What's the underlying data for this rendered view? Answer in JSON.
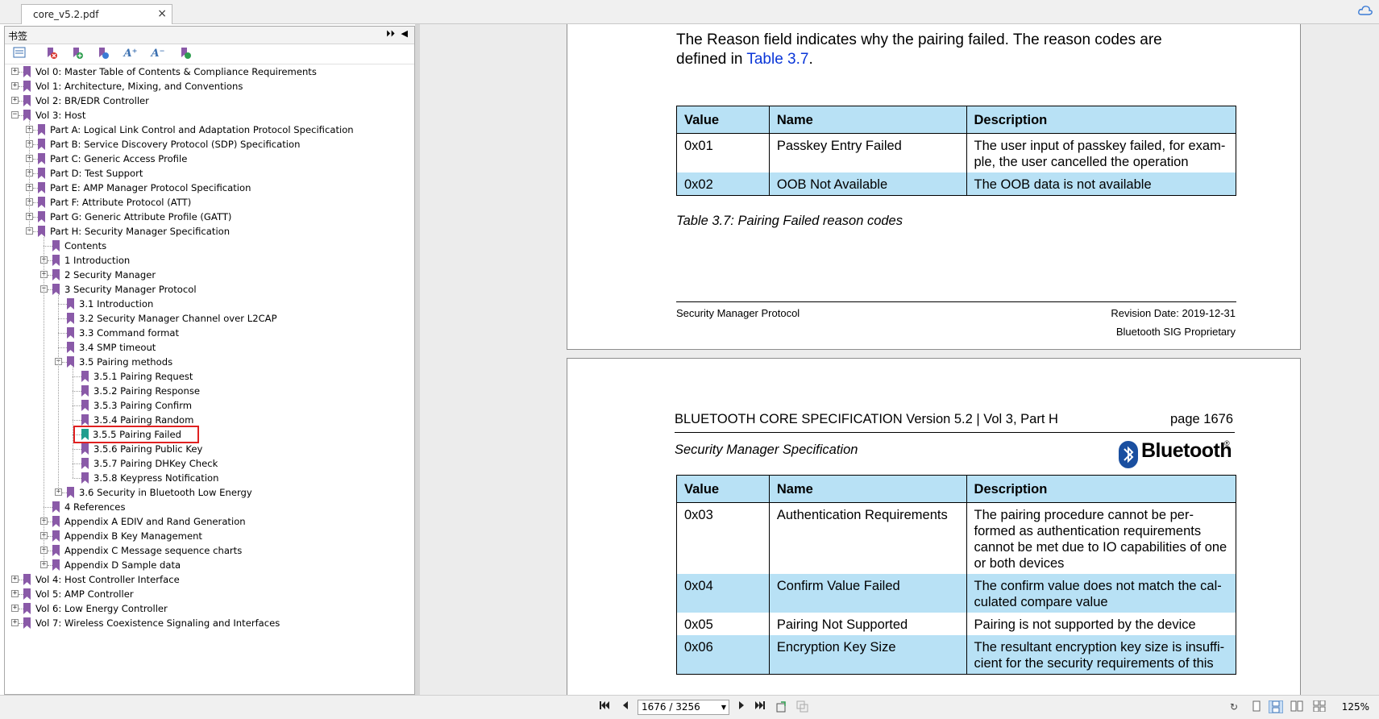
{
  "tab": {
    "title": "core_v5.2.pdf",
    "close_symbol": "×"
  },
  "sidebar": {
    "title": "书签",
    "pin_symbol": "⏵⏵",
    "collapse_symbol": "◀",
    "toolbar": {
      "aplus": "A⁺",
      "aminus": "A⁻"
    },
    "tree": [
      {
        "label": "Vol 0: Master Table of Contents & Compliance Requirements",
        "level": 0,
        "expander": "+"
      },
      {
        "label": "Vol 1: Architecture, Mixing, and Conventions",
        "level": 0,
        "expander": "+"
      },
      {
        "label": "Vol 2: BR/EDR Controller",
        "level": 0,
        "expander": "+"
      },
      {
        "label": "Vol 3: Host",
        "level": 0,
        "expander": "-"
      },
      {
        "label": "Part A: Logical Link Control and Adaptation Protocol Specification",
        "level": 1,
        "expander": "+"
      },
      {
        "label": "Part B: Service Discovery Protocol (SDP) Specification",
        "level": 1,
        "expander": "+"
      },
      {
        "label": "Part C: Generic Access Profile",
        "level": 1,
        "expander": "+"
      },
      {
        "label": "Part D: Test Support",
        "level": 1,
        "expander": "+"
      },
      {
        "label": "Part E: AMP Manager Protocol Specification",
        "level": 1,
        "expander": "+"
      },
      {
        "label": "Part F: Attribute Protocol (ATT)",
        "level": 1,
        "expander": "+"
      },
      {
        "label": "Part G: Generic Attribute Profile (GATT)",
        "level": 1,
        "expander": "+"
      },
      {
        "label": "Part H: Security Manager Specification",
        "level": 1,
        "expander": "-"
      },
      {
        "label": "Contents",
        "level": 2,
        "expander": ""
      },
      {
        "label": "1 Introduction",
        "level": 2,
        "expander": "+"
      },
      {
        "label": "2 Security Manager",
        "level": 2,
        "expander": "+"
      },
      {
        "label": "3 Security Manager Protocol",
        "level": 2,
        "expander": "-"
      },
      {
        "label": "3.1 Introduction",
        "level": 3,
        "expander": ""
      },
      {
        "label": "3.2 Security Manager Channel over L2CAP",
        "level": 3,
        "expander": ""
      },
      {
        "label": "3.3 Command format",
        "level": 3,
        "expander": ""
      },
      {
        "label": "3.4 SMP timeout",
        "level": 3,
        "expander": ""
      },
      {
        "label": "3.5 Pairing methods",
        "level": 3,
        "expander": "-"
      },
      {
        "label": "3.5.1 Pairing Request",
        "level": 4,
        "expander": ""
      },
      {
        "label": "3.5.2 Pairing Response",
        "level": 4,
        "expander": ""
      },
      {
        "label": "3.5.3 Pairing Confirm",
        "level": 4,
        "expander": ""
      },
      {
        "label": "3.5.4 Pairing Random",
        "level": 4,
        "expander": ""
      },
      {
        "label": "3.5.5 Pairing Failed",
        "level": 4,
        "expander": "",
        "selected": true
      },
      {
        "label": "3.5.6 Pairing Public Key",
        "level": 4,
        "expander": ""
      },
      {
        "label": "3.5.7 Pairing DHKey Check",
        "level": 4,
        "expander": ""
      },
      {
        "label": "3.5.8 Keypress Notification",
        "level": 4,
        "expander": ""
      },
      {
        "label": "3.6 Security in Bluetooth Low Energy",
        "level": 3,
        "expander": "+"
      },
      {
        "label": "4 References",
        "level": 2,
        "expander": ""
      },
      {
        "label": "Appendix A EDIV and Rand Generation",
        "level": 2,
        "expander": "+"
      },
      {
        "label": "Appendix B Key Management",
        "level": 2,
        "expander": "+"
      },
      {
        "label": "Appendix C Message sequence charts",
        "level": 2,
        "expander": "+"
      },
      {
        "label": "Appendix D Sample data",
        "level": 2,
        "expander": "+"
      },
      {
        "label": "Vol 4: Host Controller Interface",
        "level": 0,
        "expander": "+"
      },
      {
        "label": "Vol 5: AMP Controller",
        "level": 0,
        "expander": "+"
      },
      {
        "label": "Vol 6: Low Energy Controller",
        "level": 0,
        "expander": "+"
      },
      {
        "label": "Vol 7: Wireless Coexistence Signaling and Interfaces",
        "level": 0,
        "expander": "+"
      }
    ]
  },
  "page1": {
    "intro_line1": "The Reason field indicates why the pairing failed. The reason codes are",
    "intro_line2_prefix": "defined in ",
    "intro_link": "Table 3.7",
    "intro_line2_suffix": ".",
    "table_headers": [
      "Value",
      "Name",
      "Description"
    ],
    "rows": [
      {
        "value": "0x01",
        "name": "Passkey Entry Failed",
        "desc": [
          "The user input of passkey failed, for exam-",
          "ple, the user cancelled the operation"
        ]
      },
      {
        "value": "0x02",
        "name": "OOB Not Available",
        "desc": [
          "The OOB data is not available"
        ]
      }
    ],
    "caption": "Table 3.7:  Pairing Failed reason codes",
    "footer_left": "Security Manager Protocol",
    "footer_right1": "Revision Date: 2019-12-31",
    "footer_right2": "Bluetooth SIG Proprietary"
  },
  "page2": {
    "header_left": "BLUETOOTH CORE SPECIFICATION Version 5.2 | Vol 3, Part H",
    "header_right": "page 1676",
    "subtitle": "Security Manager Specification",
    "logo_text": "Bluetooth",
    "logo_mark": "®",
    "table_headers": [
      "Value",
      "Name",
      "Description"
    ],
    "rows": [
      {
        "value": "0x03",
        "name": "Authentication Requirements",
        "desc": [
          "The pairing procedure cannot be per-",
          "formed as authentication requirements",
          "cannot be met due to IO capabilities of one",
          "or both devices"
        ]
      },
      {
        "value": "0x04",
        "name": "Confirm Value Failed",
        "desc": [
          "The confirm value does not match the cal-",
          "culated compare value"
        ]
      },
      {
        "value": "0x05",
        "name": "Pairing Not Supported",
        "desc": [
          "Pairing is not supported by the device"
        ]
      },
      {
        "value": "0x06",
        "name": "Encryption Key Size",
        "desc": [
          "The resultant encryption key size is insuffi-",
          "cient for the security requirements of this"
        ]
      }
    ]
  },
  "statusbar": {
    "page_indicator": "1676 / 3256",
    "zoom": "125%"
  },
  "colors": {
    "bookmark": "#8a5aa8",
    "bookmark_selected": "#1f9e8e",
    "table_header": "#b8e1f5",
    "link": "#0a36d8",
    "selection_outline": "#e02020"
  }
}
